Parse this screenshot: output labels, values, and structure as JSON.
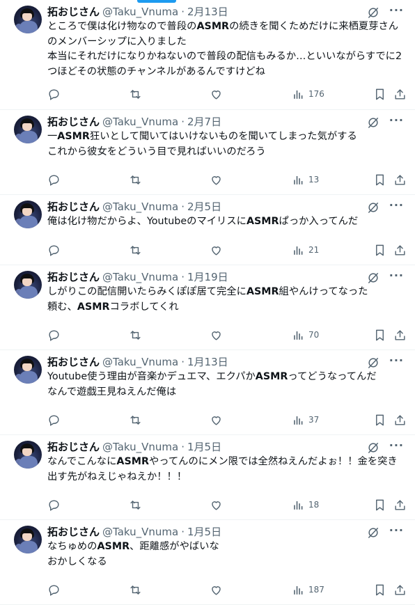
{
  "accent_color": "#1d9bf0",
  "icons": [
    "reply-icon",
    "retweet-icon",
    "like-icon",
    "views-icon",
    "bookmark-icon",
    "share-icon",
    "grok-icon",
    "more-icon"
  ],
  "tweets": [
    {
      "name": "拓おじさん",
      "handle": "@Taku_Vnuma",
      "sep": "·",
      "date": "2月13日",
      "segments": [
        [
          "ところで僕は化け物なので普段の",
          false
        ],
        [
          "ASMR",
          true
        ],
        [
          "の続きを聞くためだけに来栖夏芽さんのメンバーシップに入りました\n本当にそれだけになりかねないので普段の配信もみるか…といいながらすでに2つほどその状態のチャンネルがあるんですけどね",
          false
        ]
      ],
      "views": "176"
    },
    {
      "name": "拓おじさん",
      "handle": "@Taku_Vnuma",
      "sep": "·",
      "date": "2月7日",
      "segments": [
        [
          "一",
          false
        ],
        [
          "ASMR",
          true
        ],
        [
          "狂いとして聞いてはいけないものを聞いてしまった気がする\nこれから彼女をどういう目で見ればいいのだろう",
          false
        ]
      ],
      "views": "13"
    },
    {
      "name": "拓おじさん",
      "handle": "@Taku_Vnuma",
      "sep": "·",
      "date": "2月5日",
      "segments": [
        [
          "俺は化け物だからよ、Youtubeのマイリスに",
          false
        ],
        [
          "ASMR",
          true
        ],
        [
          "ぱっか入ってんだ",
          false
        ]
      ],
      "views": "21"
    },
    {
      "name": "拓おじさん",
      "handle": "@Taku_Vnuma",
      "sep": "·",
      "date": "1月19日",
      "segments": [
        [
          "しがりこの配信開いたらみくぽぽ居て完全に",
          false
        ],
        [
          "ASMR",
          true
        ],
        [
          "組やんけってなった\n頼む、",
          false
        ],
        [
          "ASMR",
          true
        ],
        [
          "コラボしてくれ",
          false
        ]
      ],
      "views": "70"
    },
    {
      "name": "拓おじさん",
      "handle": "@Taku_Vnuma",
      "sep": "·",
      "date": "1月13日",
      "segments": [
        [
          "Youtube使う理由が音楽かデュエマ、エクパか",
          false
        ],
        [
          "ASMR",
          true
        ],
        [
          "ってどうなってんだ\nなんで遊戯王見ねえんだ俺は",
          false
        ]
      ],
      "views": "37"
    },
    {
      "name": "拓おじさん",
      "handle": "@Taku_Vnuma",
      "sep": "·",
      "date": "1月5日",
      "segments": [
        [
          "なんでこんなに",
          false
        ],
        [
          "ASMR",
          true
        ],
        [
          "やってんのにメン限では全然ねえんだよぉ！！金を突き出す先がねえじゃねえか！！！",
          false
        ]
      ],
      "views": "18"
    },
    {
      "name": "拓おじさん",
      "handle": "@Taku_Vnuma",
      "sep": "·",
      "date": "1月5日",
      "segments": [
        [
          "なちゅめの",
          false
        ],
        [
          "ASMR",
          true
        ],
        [
          "、距離感がやばいな\nおかしくなる",
          false
        ]
      ],
      "views": "187"
    }
  ]
}
